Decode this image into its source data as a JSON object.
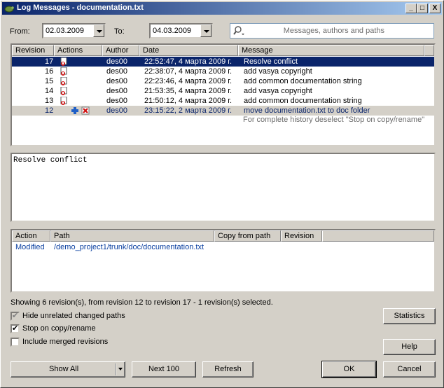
{
  "window": {
    "title": "Log Messages - documentation.txt",
    "buttons": {
      "minimize": "_",
      "maximize": "□",
      "close": "X"
    }
  },
  "filters": {
    "from_label": "From:",
    "from_date": "02.03.2009",
    "to_label": "To:",
    "to_date": "04.03.2009",
    "search_placeholder": "Messages, authors and paths"
  },
  "log_table": {
    "headers": [
      "Revision",
      "Actions",
      "Author",
      "Date",
      "Message"
    ],
    "rows": [
      {
        "revision": "17",
        "action_icons": [
          "modified-icon"
        ],
        "author": "des00",
        "date": "22:52:47, 4 марта 2009 г.",
        "message": "Resolve conflict",
        "selected": true
      },
      {
        "revision": "16",
        "action_icons": [
          "modified-icon"
        ],
        "author": "des00",
        "date": "22:38:07, 4 марта 2009 г.",
        "message": "add vasya copyright"
      },
      {
        "revision": "15",
        "action_icons": [
          "modified-icon"
        ],
        "author": "des00",
        "date": "22:23:46, 4 марта 2009 г.",
        "message": "add common documentation string"
      },
      {
        "revision": "14",
        "action_icons": [
          "modified-icon"
        ],
        "author": "des00",
        "date": "21:53:35, 4 марта 2009 г.",
        "message": "add vasya copyright"
      },
      {
        "revision": "13",
        "action_icons": [
          "modified-icon"
        ],
        "author": "des00",
        "date": "21:50:12, 4 марта 2009 г.",
        "message": "add common documentation string"
      },
      {
        "revision": "12",
        "action_icons": [
          "added-icon",
          "deleted-icon"
        ],
        "author": "des00",
        "date": "23:15:22, 2 марта 2009 г.",
        "message": "move documentation.txt to doc folder",
        "copy": true
      }
    ],
    "hint": "For complete history deselect \"Stop on copy/rename\""
  },
  "message_text": "Resolve conflict",
  "paths_table": {
    "headers": [
      "Action",
      "Path",
      "Copy from path",
      "Revision"
    ],
    "rows": [
      {
        "action": "Modified",
        "path": "/demo_project1/trunk/doc/documentation.txt",
        "copy_from": "",
        "revision": ""
      }
    ]
  },
  "status_text": "Showing 6 revision(s), from revision 12 to revision 17 - 1 revision(s) selected.",
  "options": {
    "hide_unrelated": {
      "label": "Hide unrelated changed paths",
      "checked": true,
      "disabled": true
    },
    "stop_on_copy": {
      "label": "Stop on copy/rename",
      "checked": true
    },
    "include_merged": {
      "label": "Include merged revisions",
      "checked": false
    }
  },
  "buttons": {
    "statistics": "Statistics",
    "help": "Help",
    "show_all": "Show All",
    "next_100": "Next 100",
    "refresh": "Refresh",
    "ok": "OK",
    "cancel": "Cancel"
  },
  "colors": {
    "selection": "#0a246a",
    "link_blue": "#0a246a",
    "face": "#d4d0c8"
  }
}
